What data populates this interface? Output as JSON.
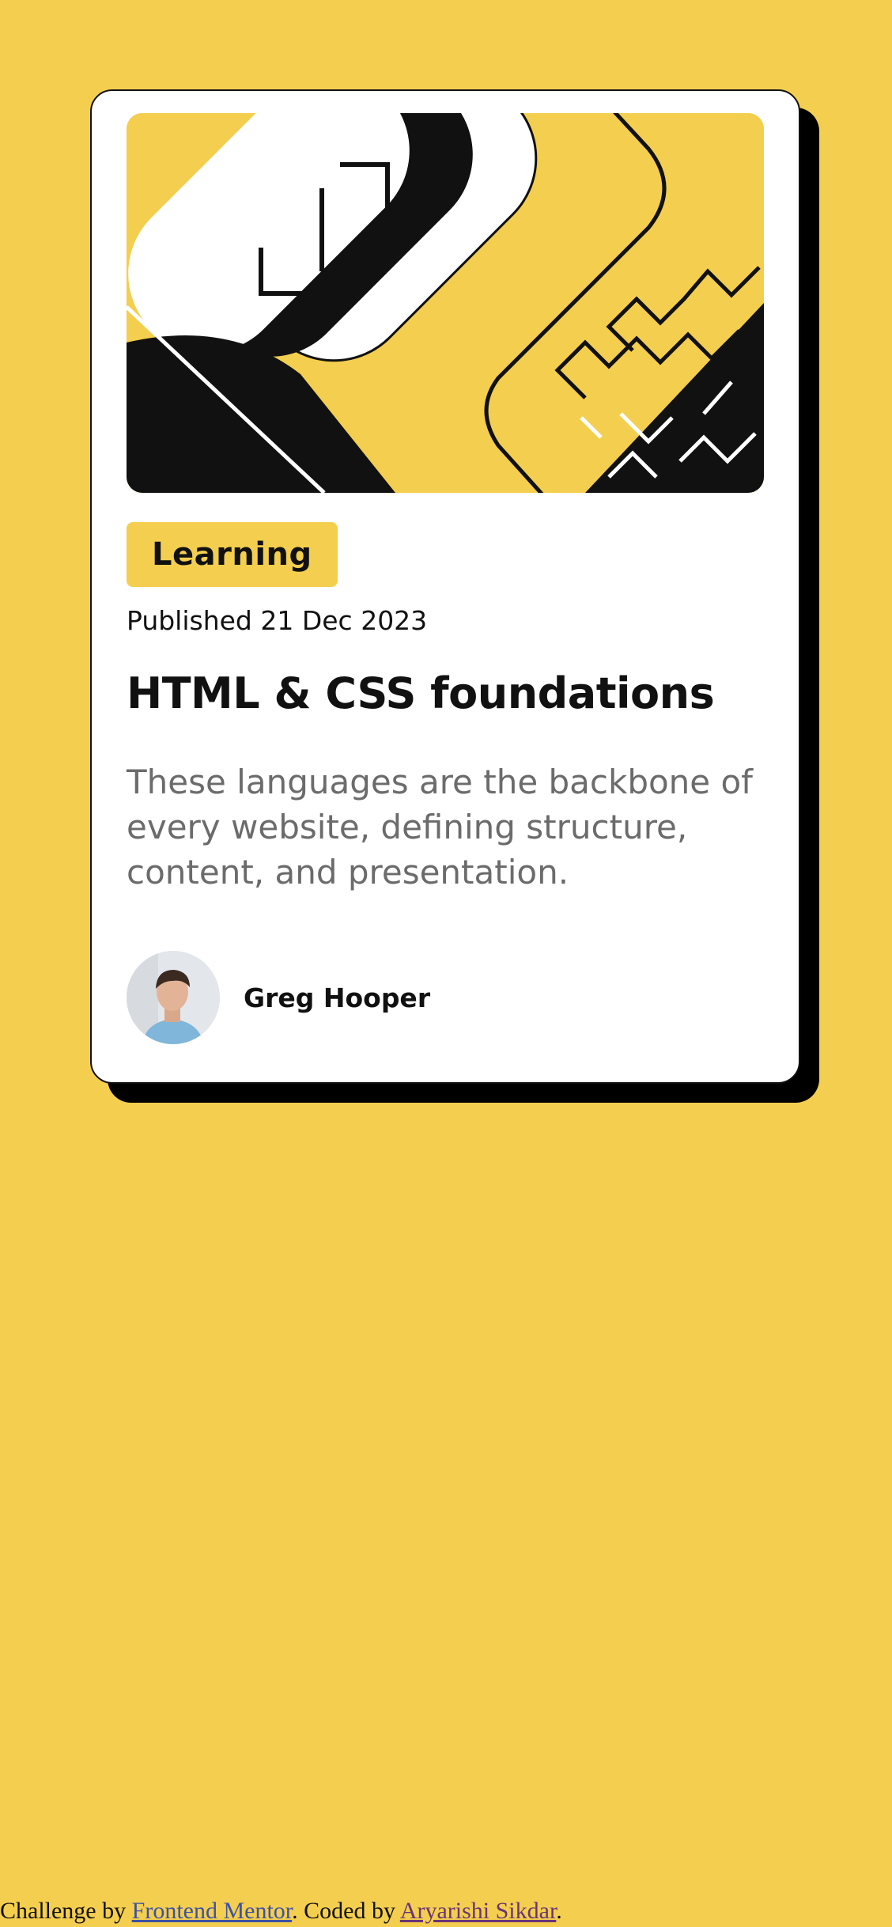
{
  "colors": {
    "background": "#F4CE4E",
    "card": "#FFFFFF",
    "shadow": "#000000",
    "text": "#111111",
    "muted_text": "#6B6B6B"
  },
  "card": {
    "illustration_icon": "abstract-geometric-illustration",
    "tag": "Learning",
    "published": "Published 21 Dec 2023",
    "title": "HTML & CSS foundations",
    "description": "These languages are the backbone of every website, defining structure, content, and presentation.",
    "author": {
      "avatar_icon": "person-avatar",
      "name": "Greg Hooper"
    }
  },
  "attribution": {
    "prefix": "Challenge by ",
    "challenge_link": "Frontend Mentor",
    "middle": ". Coded by ",
    "coder_link": "Aryarishi Sikdar",
    "suffix": "."
  }
}
